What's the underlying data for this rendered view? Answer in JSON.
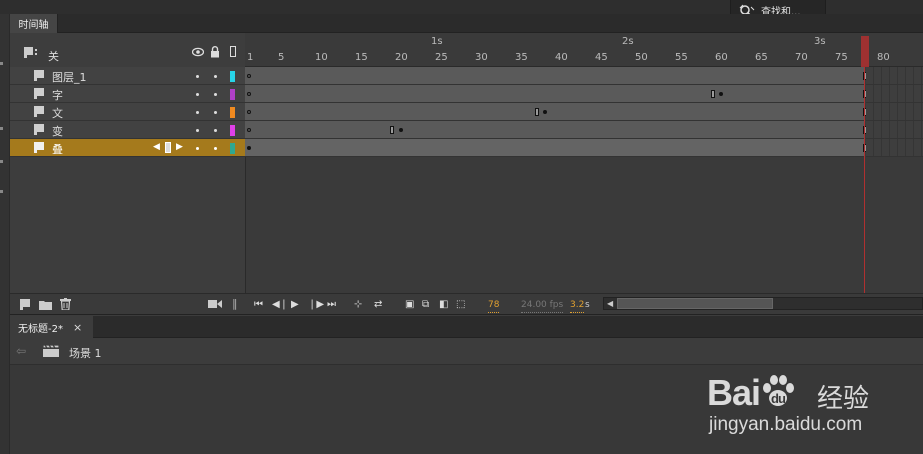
{
  "search": {
    "label": "查找和..."
  },
  "timeline_panel": {
    "tab_label": "时间轴",
    "header": {
      "layer_folder_label": "关"
    },
    "layers": [
      {
        "name": "图层_1",
        "color": "#28d4e8"
      },
      {
        "name": "字",
        "color": "#b040c8"
      },
      {
        "name": "文",
        "color": "#f08a20"
      },
      {
        "name": "变",
        "color": "#e040e8"
      },
      {
        "name": "叠",
        "color": "#30a890",
        "selected": true
      }
    ],
    "ruler_seconds": [
      "1s",
      "2s",
      "3s"
    ],
    "ruler_frames": [
      "1",
      "5",
      "10",
      "15",
      "20",
      "25",
      "30",
      "35",
      "40",
      "45",
      "50",
      "55",
      "60",
      "65",
      "70",
      "75",
      "80"
    ],
    "playback": {
      "current_frame": "78",
      "fps": "24.00 fps",
      "elapsed_time": "3.2",
      "elapsed_unit": "s"
    }
  },
  "document_panel": {
    "tab_label": "无标题-2*",
    "scene_label": "场景 1"
  },
  "watermark": {
    "brand_text": "Bai",
    "brand_text_suffix": "du",
    "brand_cn": "经验",
    "url": "jingyan.baidu.com"
  },
  "colors": {
    "selected_layer": "#a57a1c",
    "playhead": "#b03030",
    "current_frame_value": "#e0a030"
  }
}
